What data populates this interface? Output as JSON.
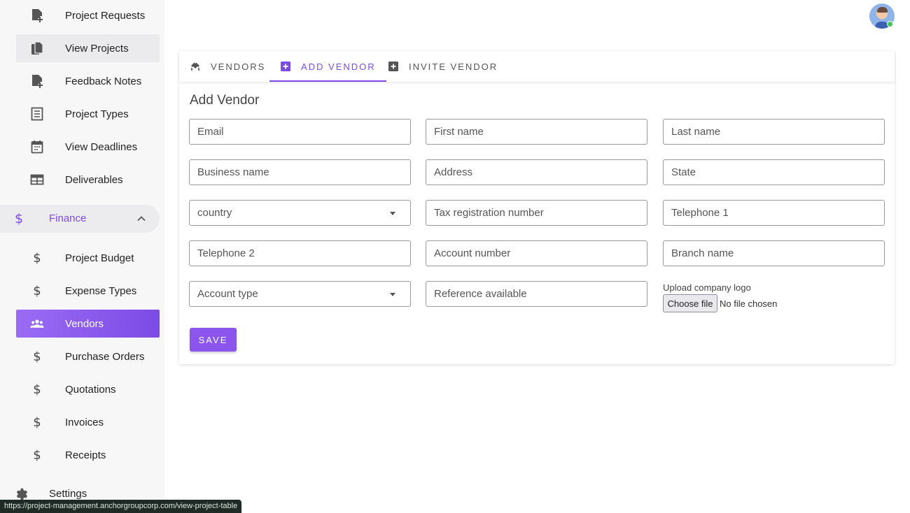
{
  "sidebar": {
    "items": [
      {
        "label": "Project Requests",
        "icon": "note-add-icon"
      },
      {
        "label": "View Projects",
        "icon": "file-copy-icon"
      },
      {
        "label": "Feedback Notes",
        "icon": "note-add-icon"
      },
      {
        "label": "Project Types",
        "icon": "list-document-icon"
      },
      {
        "label": "View Deadlines",
        "icon": "calendar-icon"
      },
      {
        "label": "Deliverables",
        "icon": "table-icon"
      }
    ],
    "finance_group": {
      "label": "Finance",
      "icon": "dollar-icon",
      "expanded": true
    },
    "finance_items": [
      {
        "label": "Project Budget",
        "icon": "dollar-icon"
      },
      {
        "label": "Expense Types",
        "icon": "dollar-icon"
      },
      {
        "label": "Vendors",
        "icon": "people-icon",
        "active": true
      },
      {
        "label": "Purchase Orders",
        "icon": "dollar-icon"
      },
      {
        "label": "Quotations",
        "icon": "dollar-icon"
      },
      {
        "label": "Invoices",
        "icon": "dollar-icon"
      },
      {
        "label": "Receipts",
        "icon": "dollar-icon"
      }
    ],
    "settings_label": "Settings"
  },
  "status_url": "https://project-management.anchorgroupcorp.com/view-project-table",
  "tabs": [
    {
      "label": "Vendors",
      "icon": "vendors-icon"
    },
    {
      "label": "Add Vendor",
      "icon": "add-box-icon",
      "active": true
    },
    {
      "label": "Invite Vendor",
      "icon": "add-box-icon"
    }
  ],
  "form": {
    "title": "Add Vendor",
    "fields": {
      "email": "Email",
      "first_name": "First name",
      "last_name": "Last name",
      "business_name": "Business name",
      "address": "Address",
      "state": "State",
      "country": "country",
      "tax_registration": "Tax registration number",
      "telephone1": "Telephone 1",
      "telephone2": "Telephone 2",
      "account_number": "Account number",
      "branch_name": "Branch name",
      "account_type": "Account type",
      "reference": "Reference available"
    },
    "upload_label": "Upload company logo",
    "choose_file": "Choose file",
    "no_file": "No file chosen",
    "save_label": "SAVE"
  },
  "colors": {
    "accent": "#7c4be6",
    "active_nav": "#9a6cf5",
    "sidebar_bg": "#f7f7f8"
  }
}
